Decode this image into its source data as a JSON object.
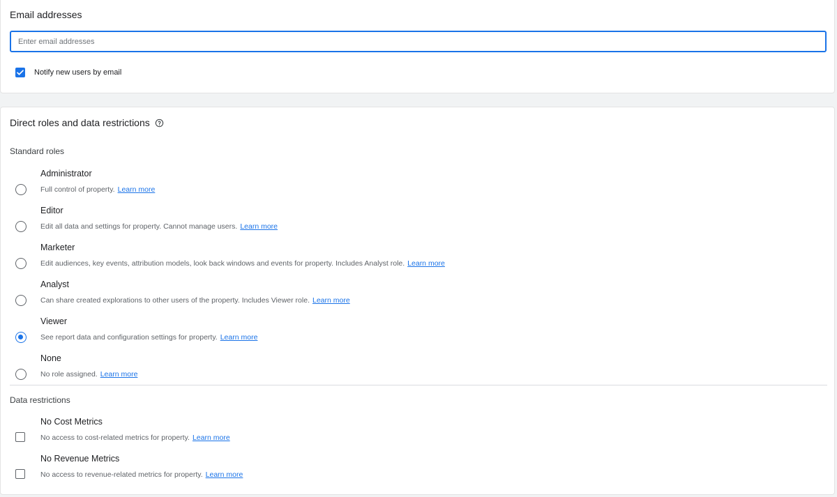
{
  "email_section": {
    "title": "Email addresses",
    "input_placeholder": "Enter email addresses",
    "input_value": "",
    "notify_label": "Notify new users by email",
    "notify_checked": true
  },
  "roles_section": {
    "title": "Direct roles and data restrictions",
    "help_icon": "help-circle-icon",
    "standard_roles_label": "Standard roles",
    "selected_role": "Viewer",
    "roles": [
      {
        "name": "Administrator",
        "description": "Full control of property.",
        "link": "Learn more"
      },
      {
        "name": "Editor",
        "description": "Edit all data and settings for property. Cannot manage users.",
        "link": "Learn more"
      },
      {
        "name": "Marketer",
        "description": "Edit audiences, key events, attribution models, look back windows and events for property. Includes Analyst role.",
        "link": "Learn more"
      },
      {
        "name": "Analyst",
        "description": "Can share created explorations to other users of the property. Includes Viewer role.",
        "link": "Learn more"
      },
      {
        "name": "Viewer",
        "description": "See report data and configuration settings for property.",
        "link": "Learn more"
      },
      {
        "name": "None",
        "description": "No role assigned.",
        "link": "Learn more"
      }
    ],
    "data_restrictions_label": "Data restrictions",
    "restrictions": [
      {
        "name": "No Cost Metrics",
        "description": "No access to cost-related metrics for property.",
        "link": "Learn more",
        "checked": false
      },
      {
        "name": "No Revenue Metrics",
        "description": "No access to revenue-related metrics for property.",
        "link": "Learn more",
        "checked": false
      }
    ]
  },
  "colors": {
    "accent": "#1a73e8",
    "text_primary": "#202124",
    "text_secondary": "#5f6368",
    "background": "#f1f3f4"
  }
}
